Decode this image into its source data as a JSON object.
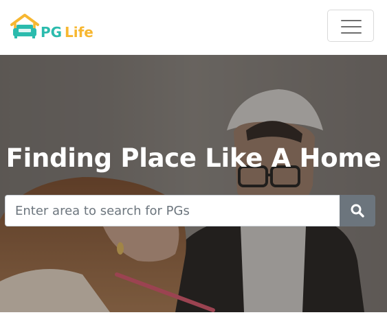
{
  "brand": {
    "name_part1": "PG",
    "name_part2": "Life",
    "colors": {
      "house": "#f7b731",
      "sofa": "#2bbbad",
      "pg_text": "#2bbbad",
      "life_text": "#f7b731"
    }
  },
  "navbar": {
    "toggler_icon": "hamburger-menu-icon"
  },
  "hero": {
    "title": "Finding Place Like A Home",
    "search": {
      "placeholder": "Enter area to search for PGs",
      "value": "",
      "button_icon": "search-icon"
    }
  }
}
